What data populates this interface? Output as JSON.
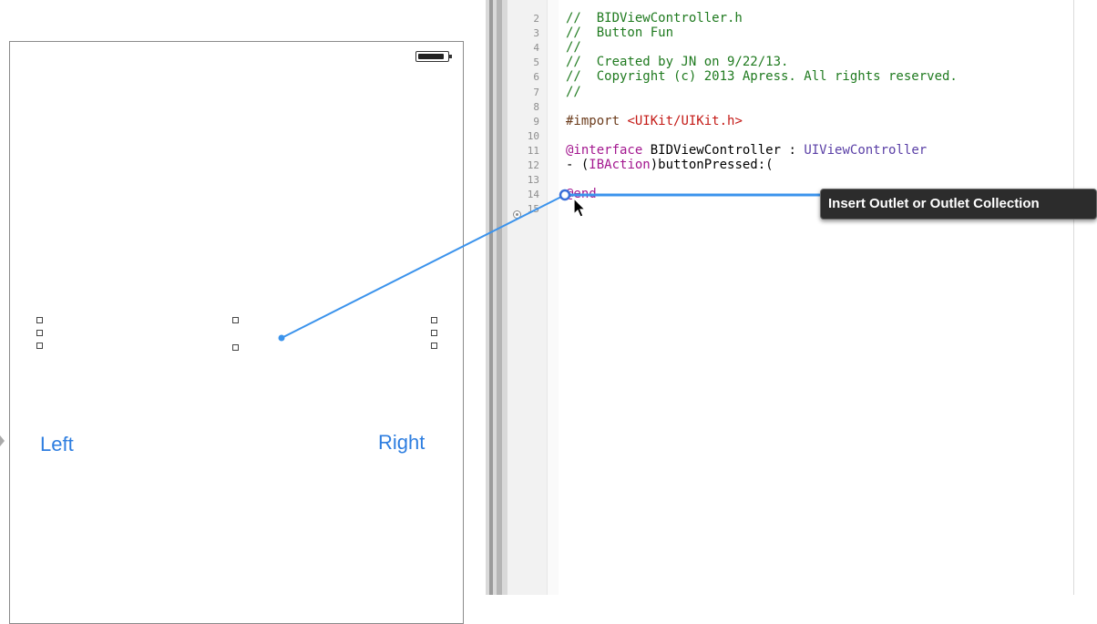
{
  "storyboard": {
    "buttons": {
      "left_label": "Left",
      "right_label": "Right"
    },
    "battery_icon": "battery-icon",
    "accent_color": "#2e7ee0"
  },
  "editor": {
    "file_name": "BIDViewController.h",
    "lines": [
      {
        "num": "2",
        "parts": [
          {
            "t": "//  BIDViewController.h",
            "k": "comment"
          }
        ]
      },
      {
        "num": "3",
        "parts": [
          {
            "t": "//  Button Fun",
            "k": "comment"
          }
        ]
      },
      {
        "num": "4",
        "parts": [
          {
            "t": "//",
            "k": "comment"
          }
        ]
      },
      {
        "num": "5",
        "parts": [
          {
            "t": "//  Created by JN on 9/22/13.",
            "k": "comment"
          }
        ]
      },
      {
        "num": "6",
        "parts": [
          {
            "t": "//  Copyright (c) 2013 Apress. All rights reserved.",
            "k": "comment"
          }
        ]
      },
      {
        "num": "7",
        "parts": [
          {
            "t": "//",
            "k": "comment"
          }
        ]
      },
      {
        "num": "8",
        "parts": []
      },
      {
        "num": "9",
        "parts": [
          {
            "t": "#import ",
            "k": "directive"
          },
          {
            "t": "<UIKit/UIKit.h>",
            "k": "string"
          }
        ]
      },
      {
        "num": "10",
        "parts": []
      },
      {
        "num": "11",
        "parts": [
          {
            "t": "@interface",
            "k": "keyword"
          },
          {
            "t": " BIDViewController : ",
            "k": "plain"
          },
          {
            "t": "UIViewController",
            "k": "class"
          }
        ]
      },
      {
        "num": "12",
        "parts": [
          {
            "t": "- (",
            "k": "plain"
          },
          {
            "t": "IBAction",
            "k": "keyword"
          },
          {
            "t": ")buttonPressed:(",
            "k": "plain"
          }
        ]
      },
      {
        "num": "13",
        "parts": []
      },
      {
        "num": "14",
        "parts": [
          {
            "t": "@end",
            "k": "keyword"
          }
        ]
      },
      {
        "num": "15",
        "parts": []
      }
    ]
  },
  "connection": {
    "tooltip": "Insert Outlet or Outlet Collection",
    "line_color": "#3b93ec"
  }
}
